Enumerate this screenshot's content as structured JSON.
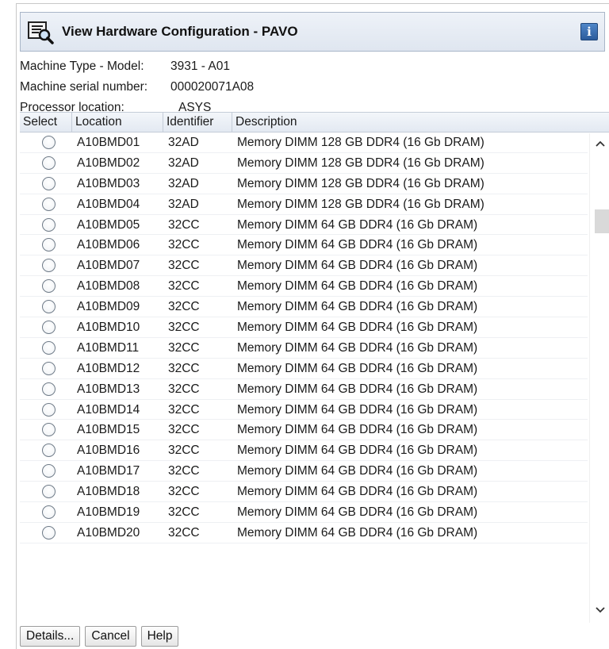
{
  "window": {
    "title": "View Hardware Configuration - PAVO",
    "title_icon": "hardware-config-icon",
    "info_icon_glyph": "i"
  },
  "meta": {
    "machine_type_label": "Machine Type - Model:",
    "machine_type_value": "3931 - A01",
    "serial_label": "Machine serial number:",
    "serial_value": "000020071A08",
    "processor_label": "Processor location:",
    "processor_value": "ASYS"
  },
  "table": {
    "columns": [
      "Select",
      "Location",
      "Identifier",
      "Description"
    ],
    "rows": [
      {
        "location": "A10BMD01",
        "identifier": "32AD",
        "description": "Memory DIMM 128 GB DDR4 (16 Gb DRAM)"
      },
      {
        "location": "A10BMD02",
        "identifier": "32AD",
        "description": "Memory DIMM 128 GB DDR4 (16 Gb DRAM)"
      },
      {
        "location": "A10BMD03",
        "identifier": "32AD",
        "description": "Memory DIMM 128 GB DDR4 (16 Gb DRAM)"
      },
      {
        "location": "A10BMD04",
        "identifier": "32AD",
        "description": "Memory DIMM 128 GB DDR4 (16 Gb DRAM)"
      },
      {
        "location": "A10BMD05",
        "identifier": "32CC",
        "description": "Memory DIMM 64 GB DDR4 (16 Gb DRAM)"
      },
      {
        "location": "A10BMD06",
        "identifier": "32CC",
        "description": "Memory DIMM 64 GB DDR4 (16 Gb DRAM)"
      },
      {
        "location": "A10BMD07",
        "identifier": "32CC",
        "description": "Memory DIMM 64 GB DDR4 (16 Gb DRAM)"
      },
      {
        "location": "A10BMD08",
        "identifier": "32CC",
        "description": "Memory DIMM 64 GB DDR4 (16 Gb DRAM)"
      },
      {
        "location": "A10BMD09",
        "identifier": "32CC",
        "description": "Memory DIMM 64 GB DDR4 (16 Gb DRAM)"
      },
      {
        "location": "A10BMD10",
        "identifier": "32CC",
        "description": "Memory DIMM 64 GB DDR4 (16 Gb DRAM)"
      },
      {
        "location": "A10BMD11",
        "identifier": "32CC",
        "description": "Memory DIMM 64 GB DDR4 (16 Gb DRAM)"
      },
      {
        "location": "A10BMD12",
        "identifier": "32CC",
        "description": "Memory DIMM 64 GB DDR4 (16 Gb DRAM)"
      },
      {
        "location": "A10BMD13",
        "identifier": "32CC",
        "description": "Memory DIMM 64 GB DDR4 (16 Gb DRAM)"
      },
      {
        "location": "A10BMD14",
        "identifier": "32CC",
        "description": "Memory DIMM 64 GB DDR4 (16 Gb DRAM)"
      },
      {
        "location": "A10BMD15",
        "identifier": "32CC",
        "description": "Memory DIMM 64 GB DDR4 (16 Gb DRAM)"
      },
      {
        "location": "A10BMD16",
        "identifier": "32CC",
        "description": "Memory DIMM 64 GB DDR4 (16 Gb DRAM)"
      },
      {
        "location": "A10BMD17",
        "identifier": "32CC",
        "description": "Memory DIMM 64 GB DDR4 (16 Gb DRAM)"
      },
      {
        "location": "A10BMD18",
        "identifier": "32CC",
        "description": "Memory DIMM 64 GB DDR4 (16 Gb DRAM)"
      },
      {
        "location": "A10BMD19",
        "identifier": "32CC",
        "description": "Memory DIMM 64 GB DDR4 (16 Gb DRAM)"
      },
      {
        "location": "A10BMD20",
        "identifier": "32CC",
        "description": "Memory DIMM 64 GB DDR4 (16 Gb DRAM)"
      }
    ]
  },
  "buttons": {
    "details": "Details...",
    "cancel": "Cancel",
    "help": "Help"
  },
  "colors": {
    "title_bar": "#dfe6f0",
    "info_icon": "#2c5c9c",
    "table_header": "#e3e9f2"
  }
}
